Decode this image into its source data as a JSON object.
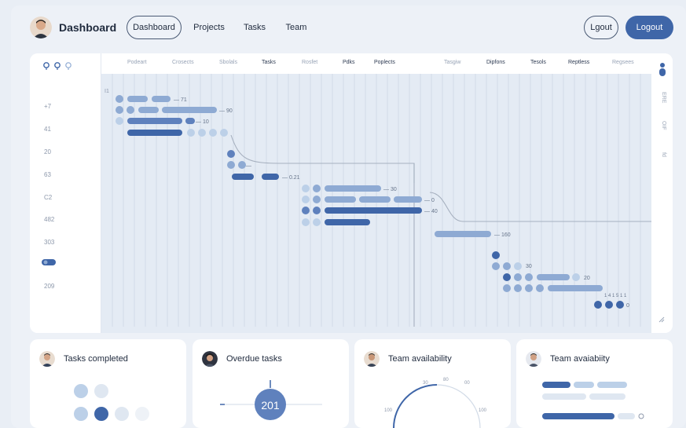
{
  "header": {
    "brand": "Dashboard",
    "nav": [
      {
        "label": "Dashboard",
        "active": true
      },
      {
        "label": "Projects"
      },
      {
        "label": "Tasks"
      },
      {
        "label": "Team"
      }
    ],
    "secondary_button": "Lgout",
    "logout_button": "Logout"
  },
  "gantt": {
    "column_headers": [
      "Podeart",
      "Crosects",
      "Sbolals",
      "Tasks",
      "Rosfet",
      "Pdks",
      "Poplects",
      "Tasgiw",
      "Dipfons",
      "Tesols",
      "Reptless",
      "Regsees"
    ],
    "row_labels": [
      "+7",
      "41",
      "20",
      "63",
      "C2",
      "482",
      "303",
      "209"
    ],
    "y_axis_marker": "I1",
    "bar_labels": [
      "— 71",
      "— 90",
      "— 10",
      "—",
      "— 0.21",
      "— 30",
      "— 0",
      "— 40",
      "— 160",
      "30",
      "20",
      "1 4 1 5 1 1",
      "0"
    ],
    "side_labels": [
      "ERE",
      "OIF",
      "fd"
    ],
    "colors": {
      "accent": "#3f66a8",
      "bar_mid": "#8eaad3",
      "bar_light": "#bcd0e8",
      "line": "#a6b0bf"
    }
  },
  "cards": [
    {
      "title": "Tasks completed"
    },
    {
      "title": "Overdue tasks",
      "value": "201"
    },
    {
      "title": "Team availability",
      "labels": [
        "30",
        "80",
        "00",
        "100",
        "100"
      ]
    },
    {
      "title": "Team avaiabiity"
    }
  ]
}
